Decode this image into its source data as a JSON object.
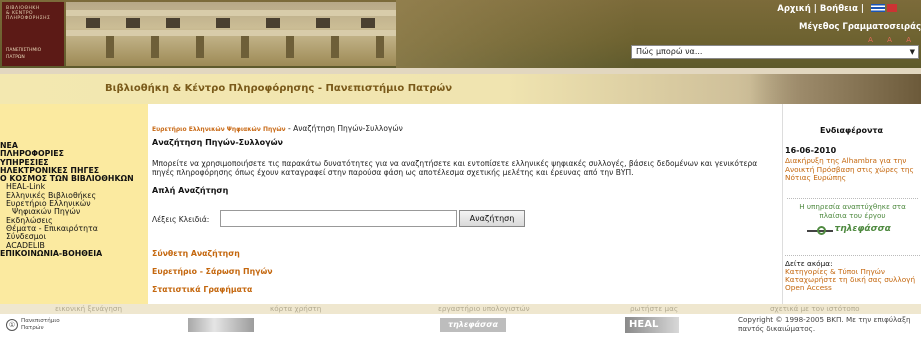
{
  "header": {
    "logo_lines_top": [
      "ΒΙΒΛΙΟΘΗΚΗ",
      "& ΚΕΝΤΡΟ",
      "ΠΛΗΡΟΦΟΡΗΣΗΣ"
    ],
    "logo_lines_bottom": [
      "ΠΑΝΕΠΙΣΤΗΜΙΟ",
      "ΠΑΤΡΩΝ"
    ],
    "home_link": "Αρχική",
    "separator": "|",
    "help_link": "Βοήθεια",
    "font_size_label": "Μέγεθος Γραμματοσειράς",
    "quick_select_value": "Πώς μπορώ να..."
  },
  "title_bar": {
    "title": "Βιβλιοθήκη & Κέντρο Πληροφόρησης - Πανεπιστήμιο Πατρών"
  },
  "left_nav": {
    "items": [
      {
        "label": "ΝΕΑ",
        "level": "top"
      },
      {
        "label": "ΠΛΗΡΟΦΟΡΙΕΣ",
        "level": "top"
      },
      {
        "label": "ΥΠΗΡΕΣΙΕΣ",
        "level": "top"
      },
      {
        "label": "ΗΛΕΚΤΡΟΝΙΚΕΣ ΠΗΓΕΣ",
        "level": "top"
      },
      {
        "label": "Ο ΚΟΣΜΟΣ ΤΩΝ ΒΙΒΛΙΟΘΗΚΩΝ",
        "level": "top"
      },
      {
        "label": "HEAL-Link",
        "level": "sub"
      },
      {
        "label": "Ελληνικές Βιβλιοθήκες",
        "level": "sub"
      },
      {
        "label": "Ευρετήριο Ελληνικών",
        "level": "sub"
      },
      {
        "label": "Ψηφιακών Πηγών",
        "level": "sub2"
      },
      {
        "label": "Εκδηλώσεις",
        "level": "sub"
      },
      {
        "label": "Θέματα - Επικαιρότητα",
        "level": "sub"
      },
      {
        "label": "Σύνδεσμοι",
        "level": "sub"
      },
      {
        "label": "ACADELIB",
        "level": "sub"
      },
      {
        "label": "ΕΠΙΚΟΙΝΩΝΙΑ-ΒΟΗΘΕΙΑ",
        "level": "top"
      }
    ]
  },
  "main": {
    "breadcrumb_link": "Ευρετήριο Ελληνικών Ψηφιακών Πηγών",
    "breadcrumb_current": " - Αναζήτηση Πηγών-Συλλογών",
    "heading": "Αναζήτηση Πηγών-Συλλογών",
    "intro": "Μπορείτε να χρησιμοποιήσετε τις παρακάτω δυνατότητες για να αναζητήσετε και εντοπίσετε ελληνικές ψηφιακές συλλογές, βάσεις δεδομένων και γενικότερα πηγές πληροφόρησης όπως έχουν καταγραφεί στην παρούσα φάση ως αποτέλεσμα σχετικής μελέτης και έρευνας από την ΒΥΠ.",
    "simple_search_title": "Απλή Αναζήτηση",
    "keywords_label": "Λέξεις Κλειδιά:",
    "keywords_value": "",
    "search_button": "Αναζήτηση",
    "advanced_search": "Σύνθετη Αναζήτηση",
    "browse_sources": "Ευρετήριο - Σάρωση Πηγών",
    "statistics": "Στατιστικά Γραφήματα"
  },
  "right_col": {
    "heading": "Ενδιαφέροντα",
    "news_date": "16-06-2010",
    "news_text": "Διακήρυξη της Alhambra για την Ανοικτή Πρόσβαση στις χώρες της Νότιας Ευρώπης",
    "promo_text": "Η υπηρεσία αναπτύχθηκε στα πλαίσια του έργου",
    "promo_logo": "τηλεφάσσα",
    "see_also_label": "Δείτε ακόμα:",
    "see_also_links": [
      "Κατηγορίες & Τύποι Πηγών",
      "Καταχωρήστε τη δική σας συλλογή",
      "Open Access"
    ]
  },
  "footer": {
    "nav": [
      "εικονική ξενάγηση",
      "κόρτα χρήστη",
      "εργαστήριο υπολογιστών",
      "ρωτήστε μας",
      "σχετικά με τον ιστότοπο"
    ],
    "logo_text_1": "Πανεπιστήμιο",
    "logo_text_2": "Πατρών",
    "banner_2": "τηλεφάσσα",
    "banner_3": "HEAL",
    "copyright": "Copyright © 1998-2005 ΒΚΠ. Με την επιφύλαξη παντός δικαιώματος."
  }
}
